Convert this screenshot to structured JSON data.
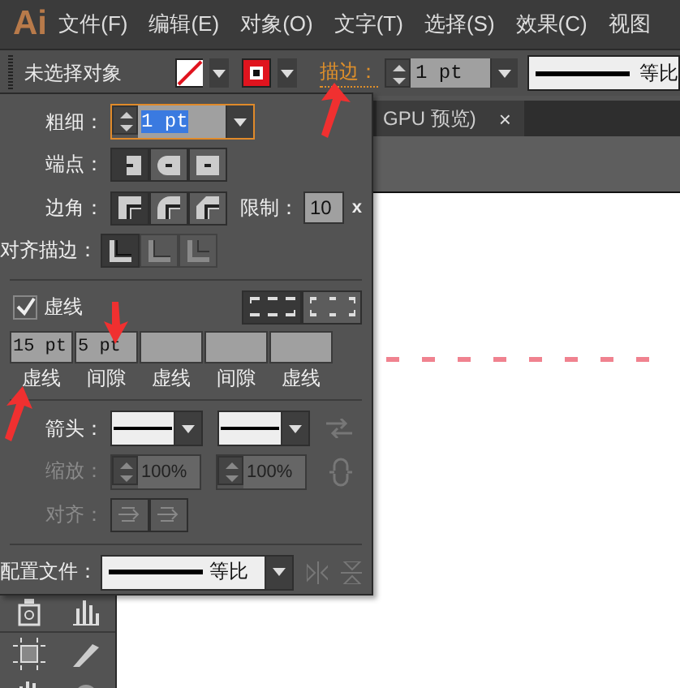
{
  "app": {
    "logo": "Ai"
  },
  "menu": [
    {
      "label": "文件(F)"
    },
    {
      "label": "编辑(E)"
    },
    {
      "label": "对象(O)"
    },
    {
      "label": "文字(T)"
    },
    {
      "label": "选择(S)"
    },
    {
      "label": "效果(C)"
    },
    {
      "label": "视图"
    }
  ],
  "control_bar": {
    "selection": "未选择对象",
    "stroke_label": "描边：",
    "stroke_weight": "1 pt",
    "profile": "等比"
  },
  "document_tab": {
    "title": "GPU 预览)",
    "close": "×"
  },
  "stroke_panel": {
    "weight": {
      "label": "粗细：",
      "value": "1 pt"
    },
    "cap": {
      "label": "端点：",
      "options": [
        {
          "selected": true
        },
        {
          "selected": false
        },
        {
          "selected": false
        }
      ]
    },
    "corner": {
      "label": "边角：",
      "options": [
        {
          "selected": true
        },
        {
          "selected": false
        },
        {
          "selected": false
        }
      ],
      "limit_label": "限制：",
      "limit": "10",
      "limit_unit": "x"
    },
    "align_stroke": {
      "label": "对齐描边：",
      "options": [
        {
          "selected": true,
          "disabled": false
        },
        {
          "selected": false,
          "disabled": true
        },
        {
          "selected": false,
          "disabled": true
        }
      ]
    },
    "dashed": {
      "label": "虚线",
      "checked": true,
      "modes": [
        {
          "selected": true
        },
        {
          "selected": false
        }
      ],
      "fields": [
        {
          "value": "15 pt",
          "label": "虚线"
        },
        {
          "value": "5 pt",
          "label": "间隙"
        },
        {
          "label": "虚线"
        },
        {
          "label": "间隙"
        },
        {
          "label": "虚线"
        }
      ]
    },
    "arrowheads": {
      "label": "箭头：",
      "disabled": false
    },
    "scale": {
      "label": "缩放：",
      "values": [
        "100%",
        "100%"
      ],
      "disabled": true
    },
    "align": {
      "label": "对齐：",
      "disabled": true
    },
    "profile": {
      "label": "配置文件：",
      "value": "等比"
    }
  }
}
